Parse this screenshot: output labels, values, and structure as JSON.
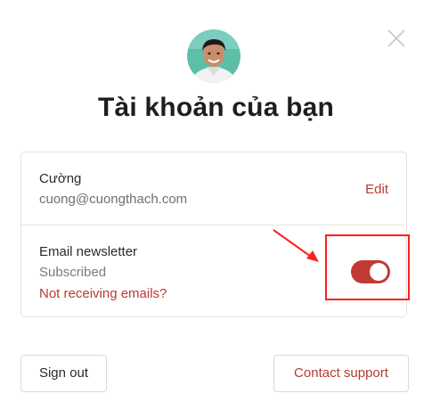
{
  "header": {
    "title": "Tài khoản của bạn",
    "close_icon": "close-icon",
    "avatar_icon": "avatar"
  },
  "account": {
    "name": "Cường",
    "email": "cuong@cuongthach.com",
    "edit_label": "Edit"
  },
  "newsletter": {
    "title": "Email newsletter",
    "status": "Subscribed",
    "link_label": "Not receiving emails?",
    "toggle_on": true
  },
  "footer": {
    "sign_out_label": "Sign out",
    "contact_support_label": "Contact support"
  },
  "colors": {
    "accent": "#b83a35",
    "toggle_on": "#c13a33",
    "annotation": "#ff1f1f"
  }
}
